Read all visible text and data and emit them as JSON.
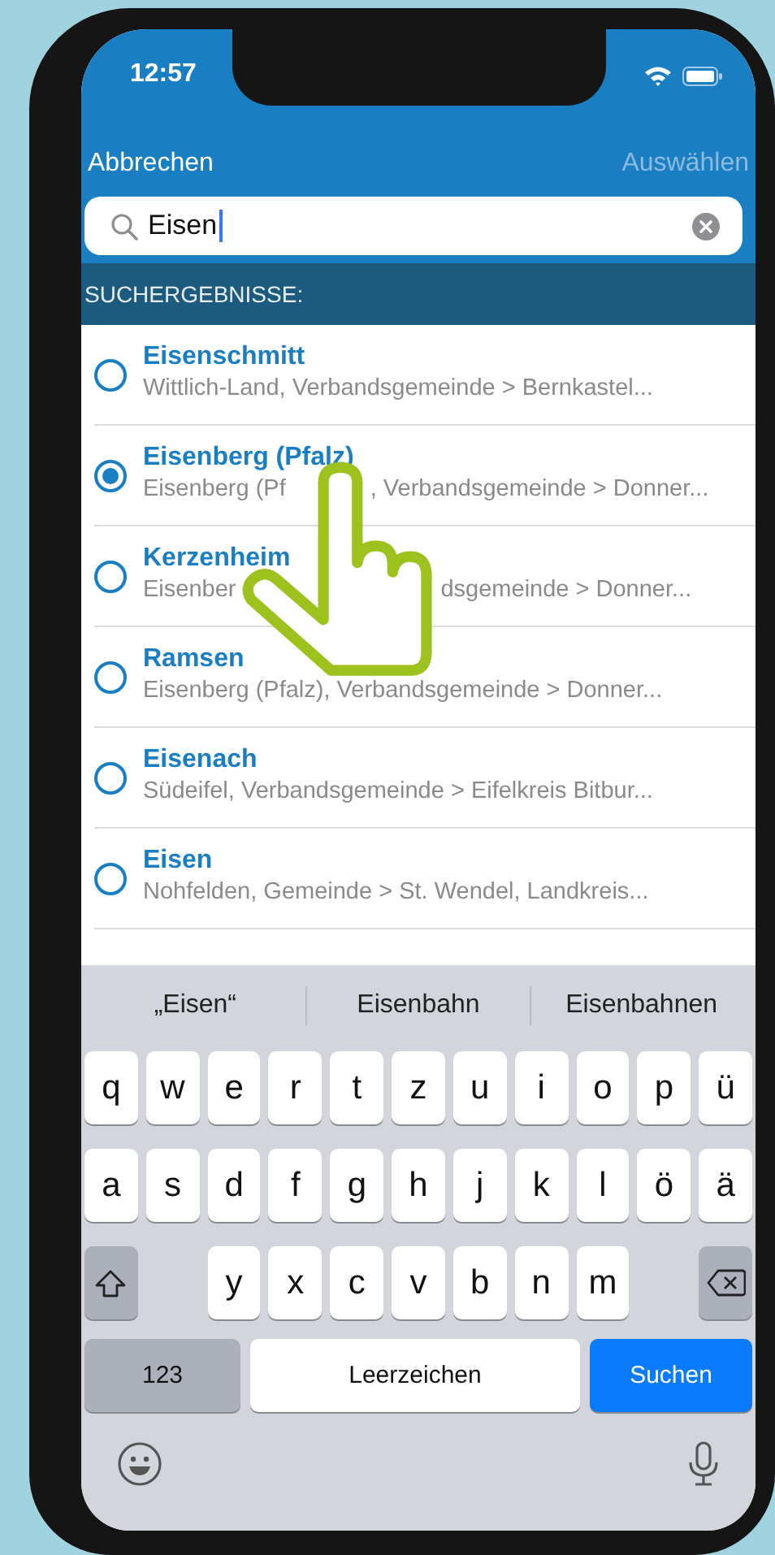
{
  "status_bar": {
    "time": "12:57"
  },
  "nav": {
    "cancel": "Abbrechen",
    "select": {
      "label": "Auswählen",
      "disabled": true
    }
  },
  "search": {
    "value": "Eisen"
  },
  "section_header": "SUCHERGEBNISSE:",
  "results": [
    {
      "name": "Eisenschmitt",
      "detail": "Wittlich-Land, Verbandsgemeinde > Bernkastel...",
      "selected": false
    },
    {
      "name": "Eisenberg (Pfalz)",
      "detail": [
        "Eisenberg (Pf",
        ", Verbandsgemeinde > Donner..."
      ],
      "selected": true
    },
    {
      "name": "Kerzenheim",
      "detail": [
        "Eisenber",
        "dsgemeinde > Donner..."
      ],
      "selected": false
    },
    {
      "name": "Ramsen",
      "detail": "Eisenberg (Pfalz), Verbandsgemeinde > Donner...",
      "selected": false
    },
    {
      "name": "Eisenach",
      "detail": "Südeifel, Verbandsgemeinde > Eifelkreis Bitbur...",
      "selected": false
    },
    {
      "name": "Eisen",
      "detail": "Nohfelden, Gemeinde > St. Wendel, Landkreis...",
      "selected": false
    }
  ],
  "keyboard": {
    "suggestions": [
      "„Eisen“",
      "Eisenbahn",
      "Eisenbahnen"
    ],
    "rows": [
      [
        "q",
        "w",
        "e",
        "r",
        "t",
        "z",
        "u",
        "i",
        "o",
        "p",
        "ü"
      ],
      [
        "a",
        "s",
        "d",
        "f",
        "g",
        "h",
        "j",
        "k",
        "l",
        "ö",
        "ä"
      ],
      [
        "",
        "",
        "y",
        "x",
        "c",
        "v",
        "b",
        "n",
        "m",
        "",
        ""
      ]
    ],
    "numbers_key": "123",
    "space_key": "Leerzeichen",
    "action_key": "Suchen"
  }
}
